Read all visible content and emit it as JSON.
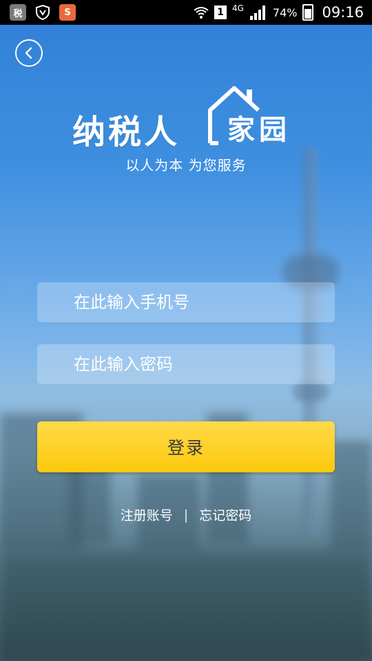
{
  "status_bar": {
    "app_icon_tax_label": "税",
    "app_icon_sogou_label": "S",
    "sim_slot": "1",
    "network": "4G",
    "battery": "74%",
    "time": "09:16"
  },
  "header": {
    "back_icon": "chevron-left-icon"
  },
  "logo": {
    "title": "纳税人",
    "title_home": "家园",
    "slogan": "以人为本 为您服务"
  },
  "form": {
    "phone_placeholder": "在此输入手机号",
    "password_placeholder": "在此输入密码",
    "login_label": "登录"
  },
  "links": {
    "register": "注册账号",
    "separator": "|",
    "forgot_password": "忘记密码"
  },
  "colors": {
    "accent_button": "#fcc90b",
    "background_top": "#2f7fd8"
  }
}
